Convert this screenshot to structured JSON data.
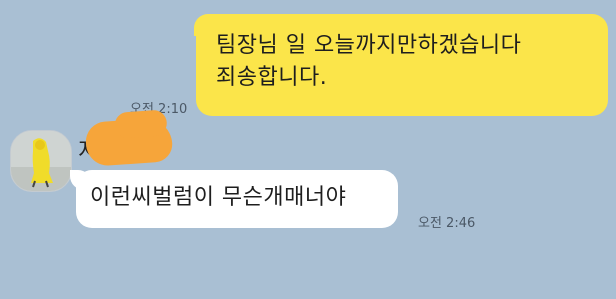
{
  "chat": {
    "outgoing": {
      "message": "팀장님 일 오늘까지만하겠습니다\n죄송합니다.",
      "time": "오전 2:10"
    },
    "incoming": {
      "sender_name": "지",
      "message": "이런씨벌럼이 무슨개매너야",
      "time": "오전 2:46"
    }
  },
  "colors": {
    "background": "#a9bfd3",
    "outgoing_bubble": "#fbe54a",
    "incoming_bubble": "#ffffff",
    "name_redaction": "#f6a53a"
  },
  "icons": {
    "avatar": "profile-photo-yellow-raincoat"
  }
}
